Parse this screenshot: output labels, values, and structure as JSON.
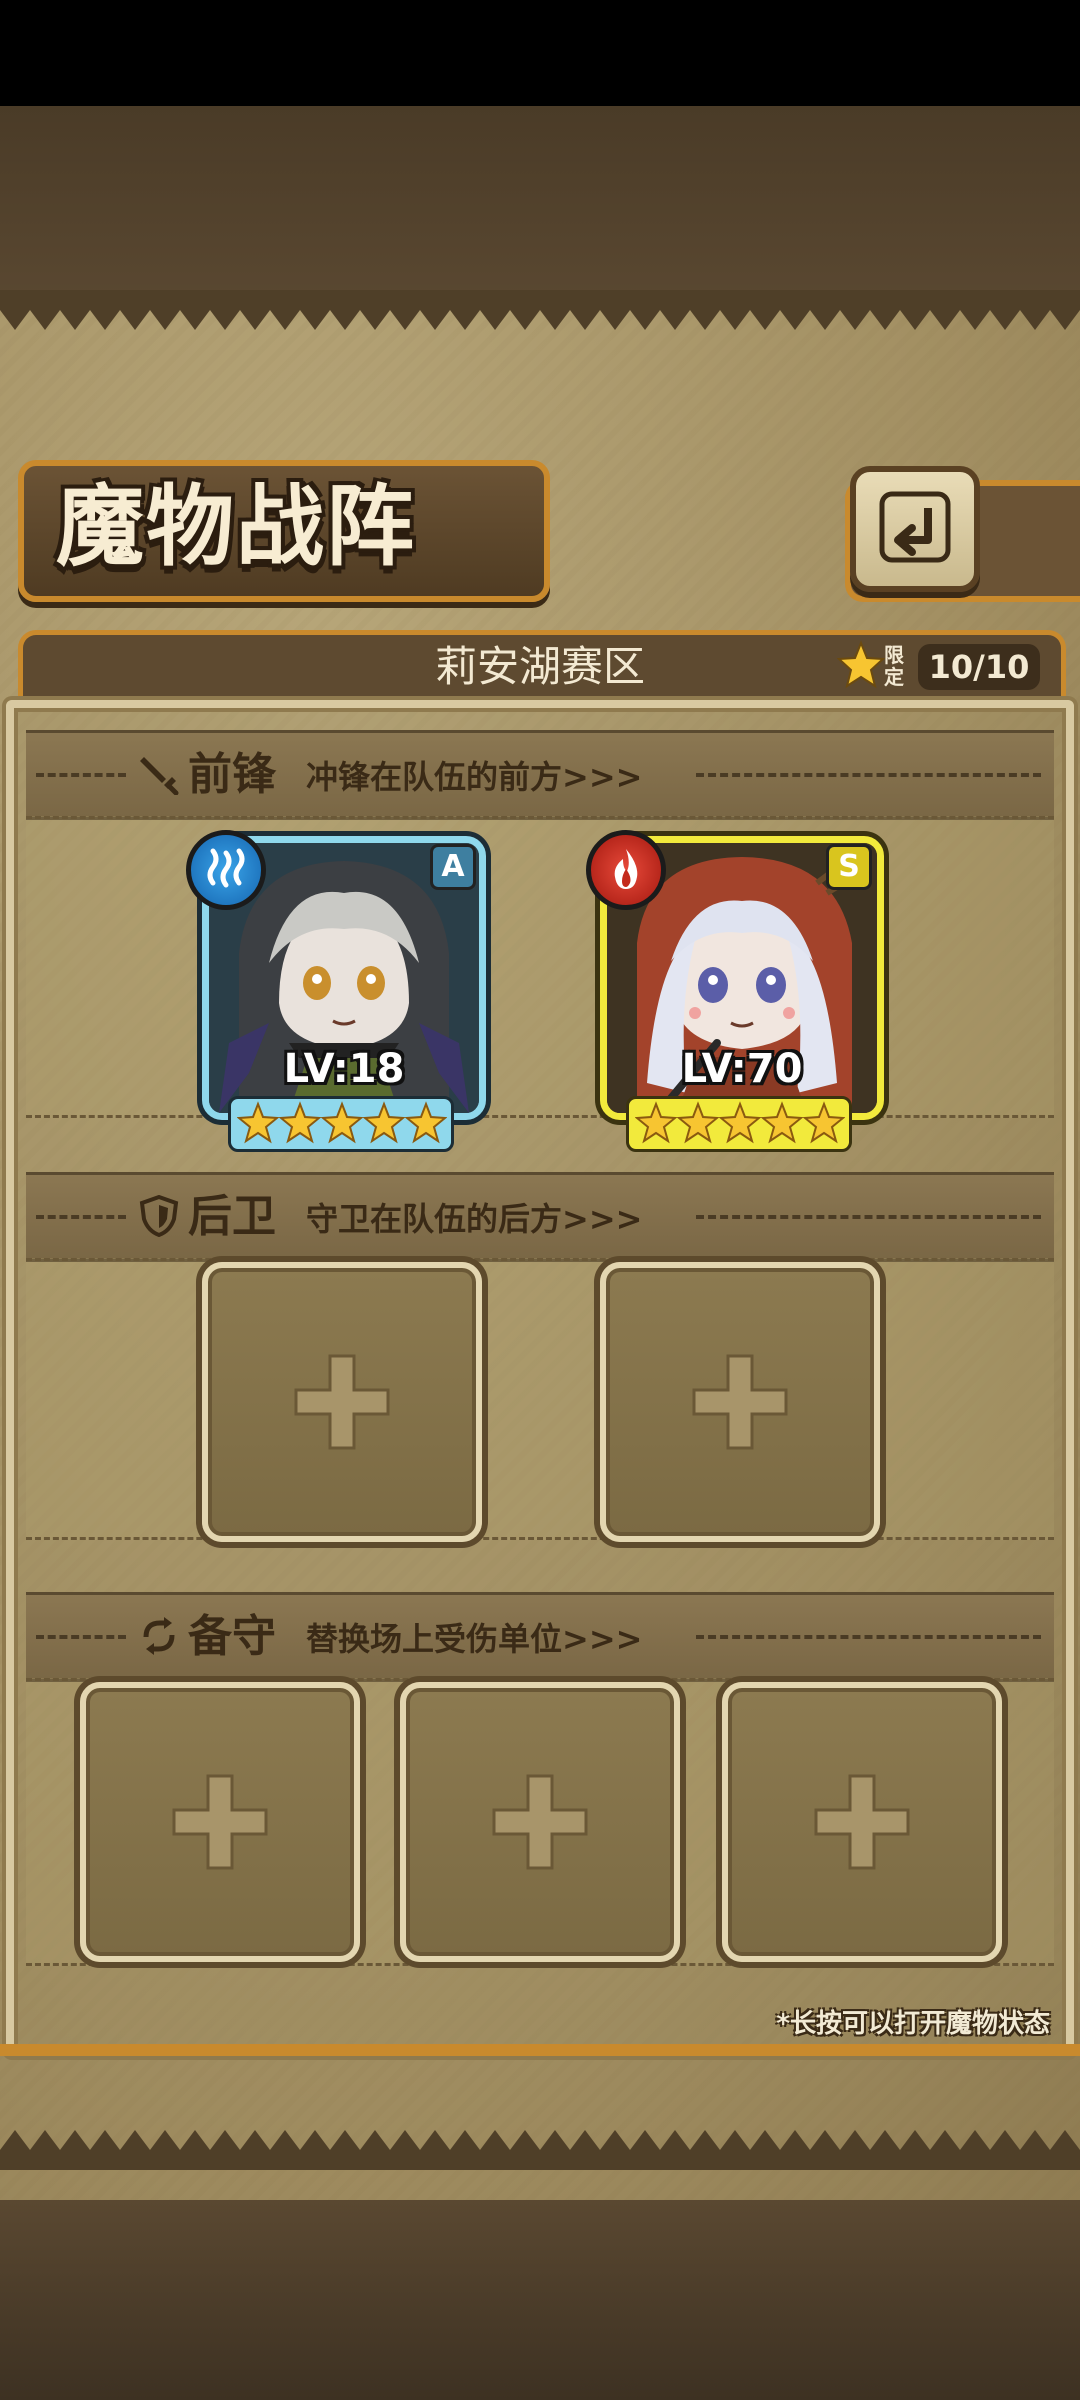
{
  "header": {
    "title": "魔物战阵",
    "back_icon": "return-arrow-icon"
  },
  "region": {
    "name": "莉安湖赛区",
    "limit_label": "限定",
    "limit_counter": "10/10"
  },
  "sections": {
    "vanguard": {
      "title": "前锋",
      "description": "冲锋在队伍的前方>>>",
      "icon": "sword-icon"
    },
    "rearguard": {
      "title": "后卫",
      "description": "守卫在队伍的后方>>>",
      "icon": "shield-icon"
    },
    "reserve": {
      "title": "备守",
      "description": "替换场上受伤单位>>>",
      "icon": "swap-icon"
    }
  },
  "vanguard_units": [
    {
      "rank": "A",
      "element": "water",
      "level": "LV:18",
      "stars": 5,
      "frame_color": "#8fd8ec"
    },
    {
      "rank": "S",
      "element": "fire",
      "level": "LV:70",
      "stars": 5,
      "frame_color": "#f2ea3c"
    }
  ],
  "hint": "*长按可以打开魔物状态",
  "colors": {
    "accent_orange": "#c98a2d",
    "parchment": "#a28f62",
    "dark_text": "#3a2a16",
    "star_gold": "#f7c531"
  }
}
